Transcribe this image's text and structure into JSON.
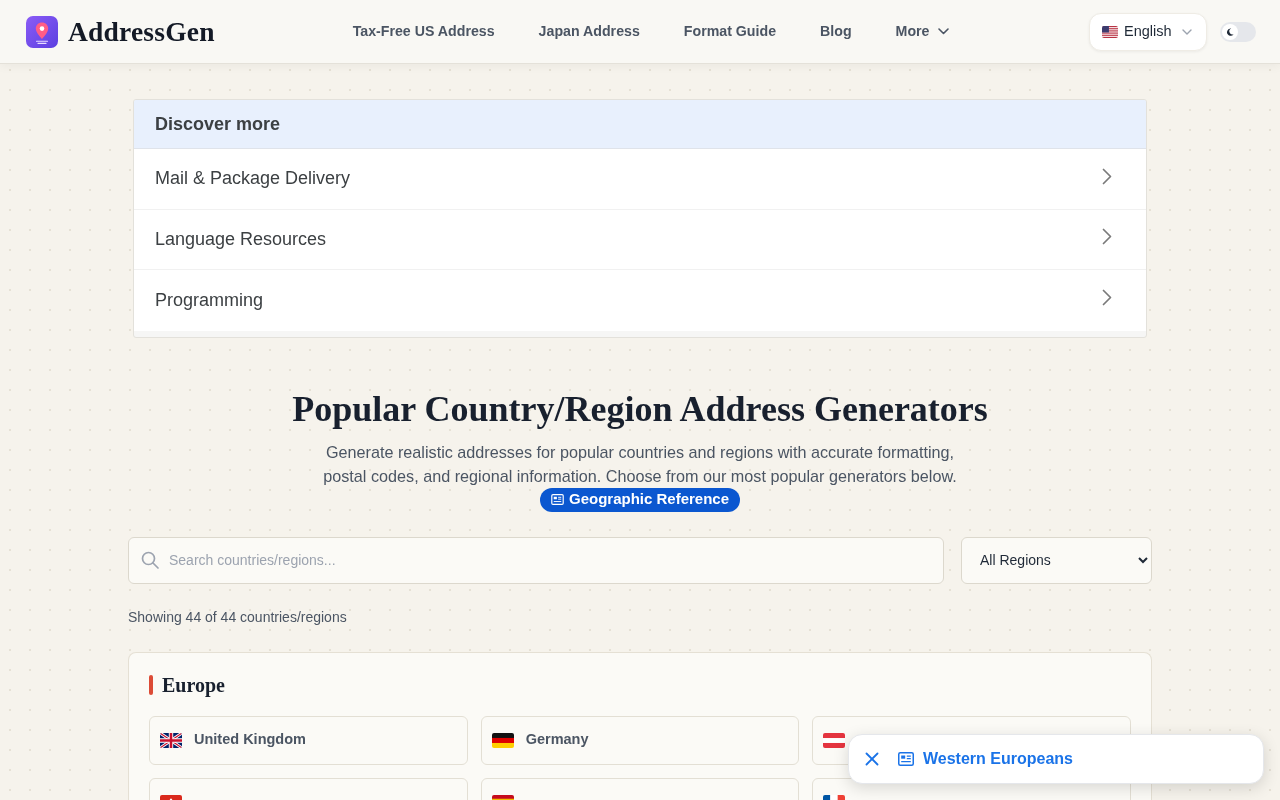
{
  "header": {
    "logo": "AddressGen",
    "nav": [
      {
        "label": "Tax-Free US Address",
        "kind": "link"
      },
      {
        "label": "Japan Address",
        "kind": "link"
      },
      {
        "label": "Format Guide",
        "kind": "link"
      },
      {
        "label": "Blog",
        "kind": "link"
      },
      {
        "label": "More",
        "kind": "dropdown"
      }
    ],
    "language": {
      "label": "English"
    },
    "dark_mode": {
      "on": false
    }
  },
  "discover": {
    "title": "Discover more",
    "items": [
      "Mail & Package Delivery",
      "Language Resources",
      "Programming"
    ]
  },
  "intro": {
    "title": "Popular Country/Region Address Generators",
    "description": "Generate realistic addresses for popular countries and regions with accurate formatting, postal codes, and regional information. Choose from our most popular generators below.",
    "badge": "Geographic Reference"
  },
  "search": {
    "placeholder": "Search countries/regions..."
  },
  "region_filter": {
    "value": "All Regions"
  },
  "result_count": "Showing 44 of 44 countries/regions",
  "groups": [
    {
      "name": "Europe",
      "countries": [
        {
          "name": "United Kingdom",
          "kind": "uk"
        },
        {
          "name": "Germany",
          "kind": "germany"
        },
        {
          "kind": "austria"
        },
        {
          "kind": "switzerland"
        },
        {
          "kind": "spain"
        },
        {
          "kind": "france"
        }
      ]
    }
  ],
  "toast": {
    "label": "Western Europeans"
  }
}
